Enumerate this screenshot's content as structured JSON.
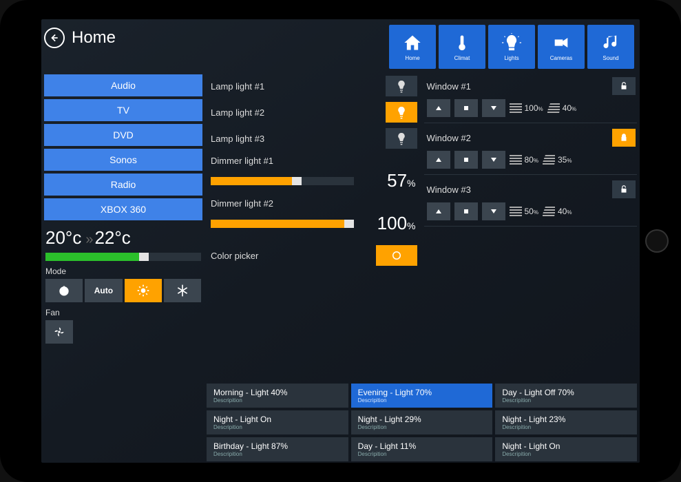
{
  "page": {
    "title": "Home"
  },
  "topnav": [
    {
      "label": "Home",
      "icon": "home"
    },
    {
      "label": "Climat",
      "icon": "thermometer"
    },
    {
      "label": "Lights",
      "icon": "lightbulb"
    },
    {
      "label": "Cameras",
      "icon": "camera"
    },
    {
      "label": "Sound",
      "icon": "music"
    }
  ],
  "sidebar": {
    "items": [
      "Audio",
      "TV",
      "DVD",
      "Sonos",
      "Radio",
      "XBOX 360"
    ]
  },
  "climate": {
    "current": "20°c",
    "target": "22°c",
    "mode_label": "Mode",
    "mode_auto": "Auto",
    "fan_label": "Fan"
  },
  "lamps": [
    {
      "label": "Lamp light #1",
      "on": false
    },
    {
      "label": "Lamp light #2",
      "on": true
    },
    {
      "label": "Lamp light #3",
      "on": false
    }
  ],
  "dimmers": [
    {
      "label": "Dimmer light #1",
      "value": 57
    },
    {
      "label": "Dimmer light #2",
      "value": 100
    }
  ],
  "color_picker": {
    "label": "Color picker"
  },
  "windows": [
    {
      "label": "Window #1",
      "locked": false,
      "open_pct": 100,
      "tilt_pct": 40
    },
    {
      "label": "Window #2",
      "locked": true,
      "open_pct": 80,
      "tilt_pct": 35
    },
    {
      "label": "Window #3",
      "locked": false,
      "open_pct": 50,
      "tilt_pct": 40
    }
  ],
  "scenes": [
    {
      "title": "Morning - Light 40%",
      "sub": "Descripition",
      "active": false
    },
    {
      "title": "Evening - Light 70%",
      "sub": "Descripition",
      "active": true
    },
    {
      "title": "Day - Light Off 70%",
      "sub": "Descripition",
      "active": false
    },
    {
      "title": "Night - Light On",
      "sub": "Descripition",
      "active": false
    },
    {
      "title": "Night - Light 29%",
      "sub": "Descripition",
      "active": false
    },
    {
      "title": "Night - Light 23%",
      "sub": "Descripition",
      "active": false
    },
    {
      "title": "Birthday - Light 87%",
      "sub": "Descripition",
      "active": false
    },
    {
      "title": "Day - Light 11%",
      "sub": "Descripition",
      "active": false
    },
    {
      "title": "Night - Light On",
      "sub": "Descripition",
      "active": false
    }
  ]
}
